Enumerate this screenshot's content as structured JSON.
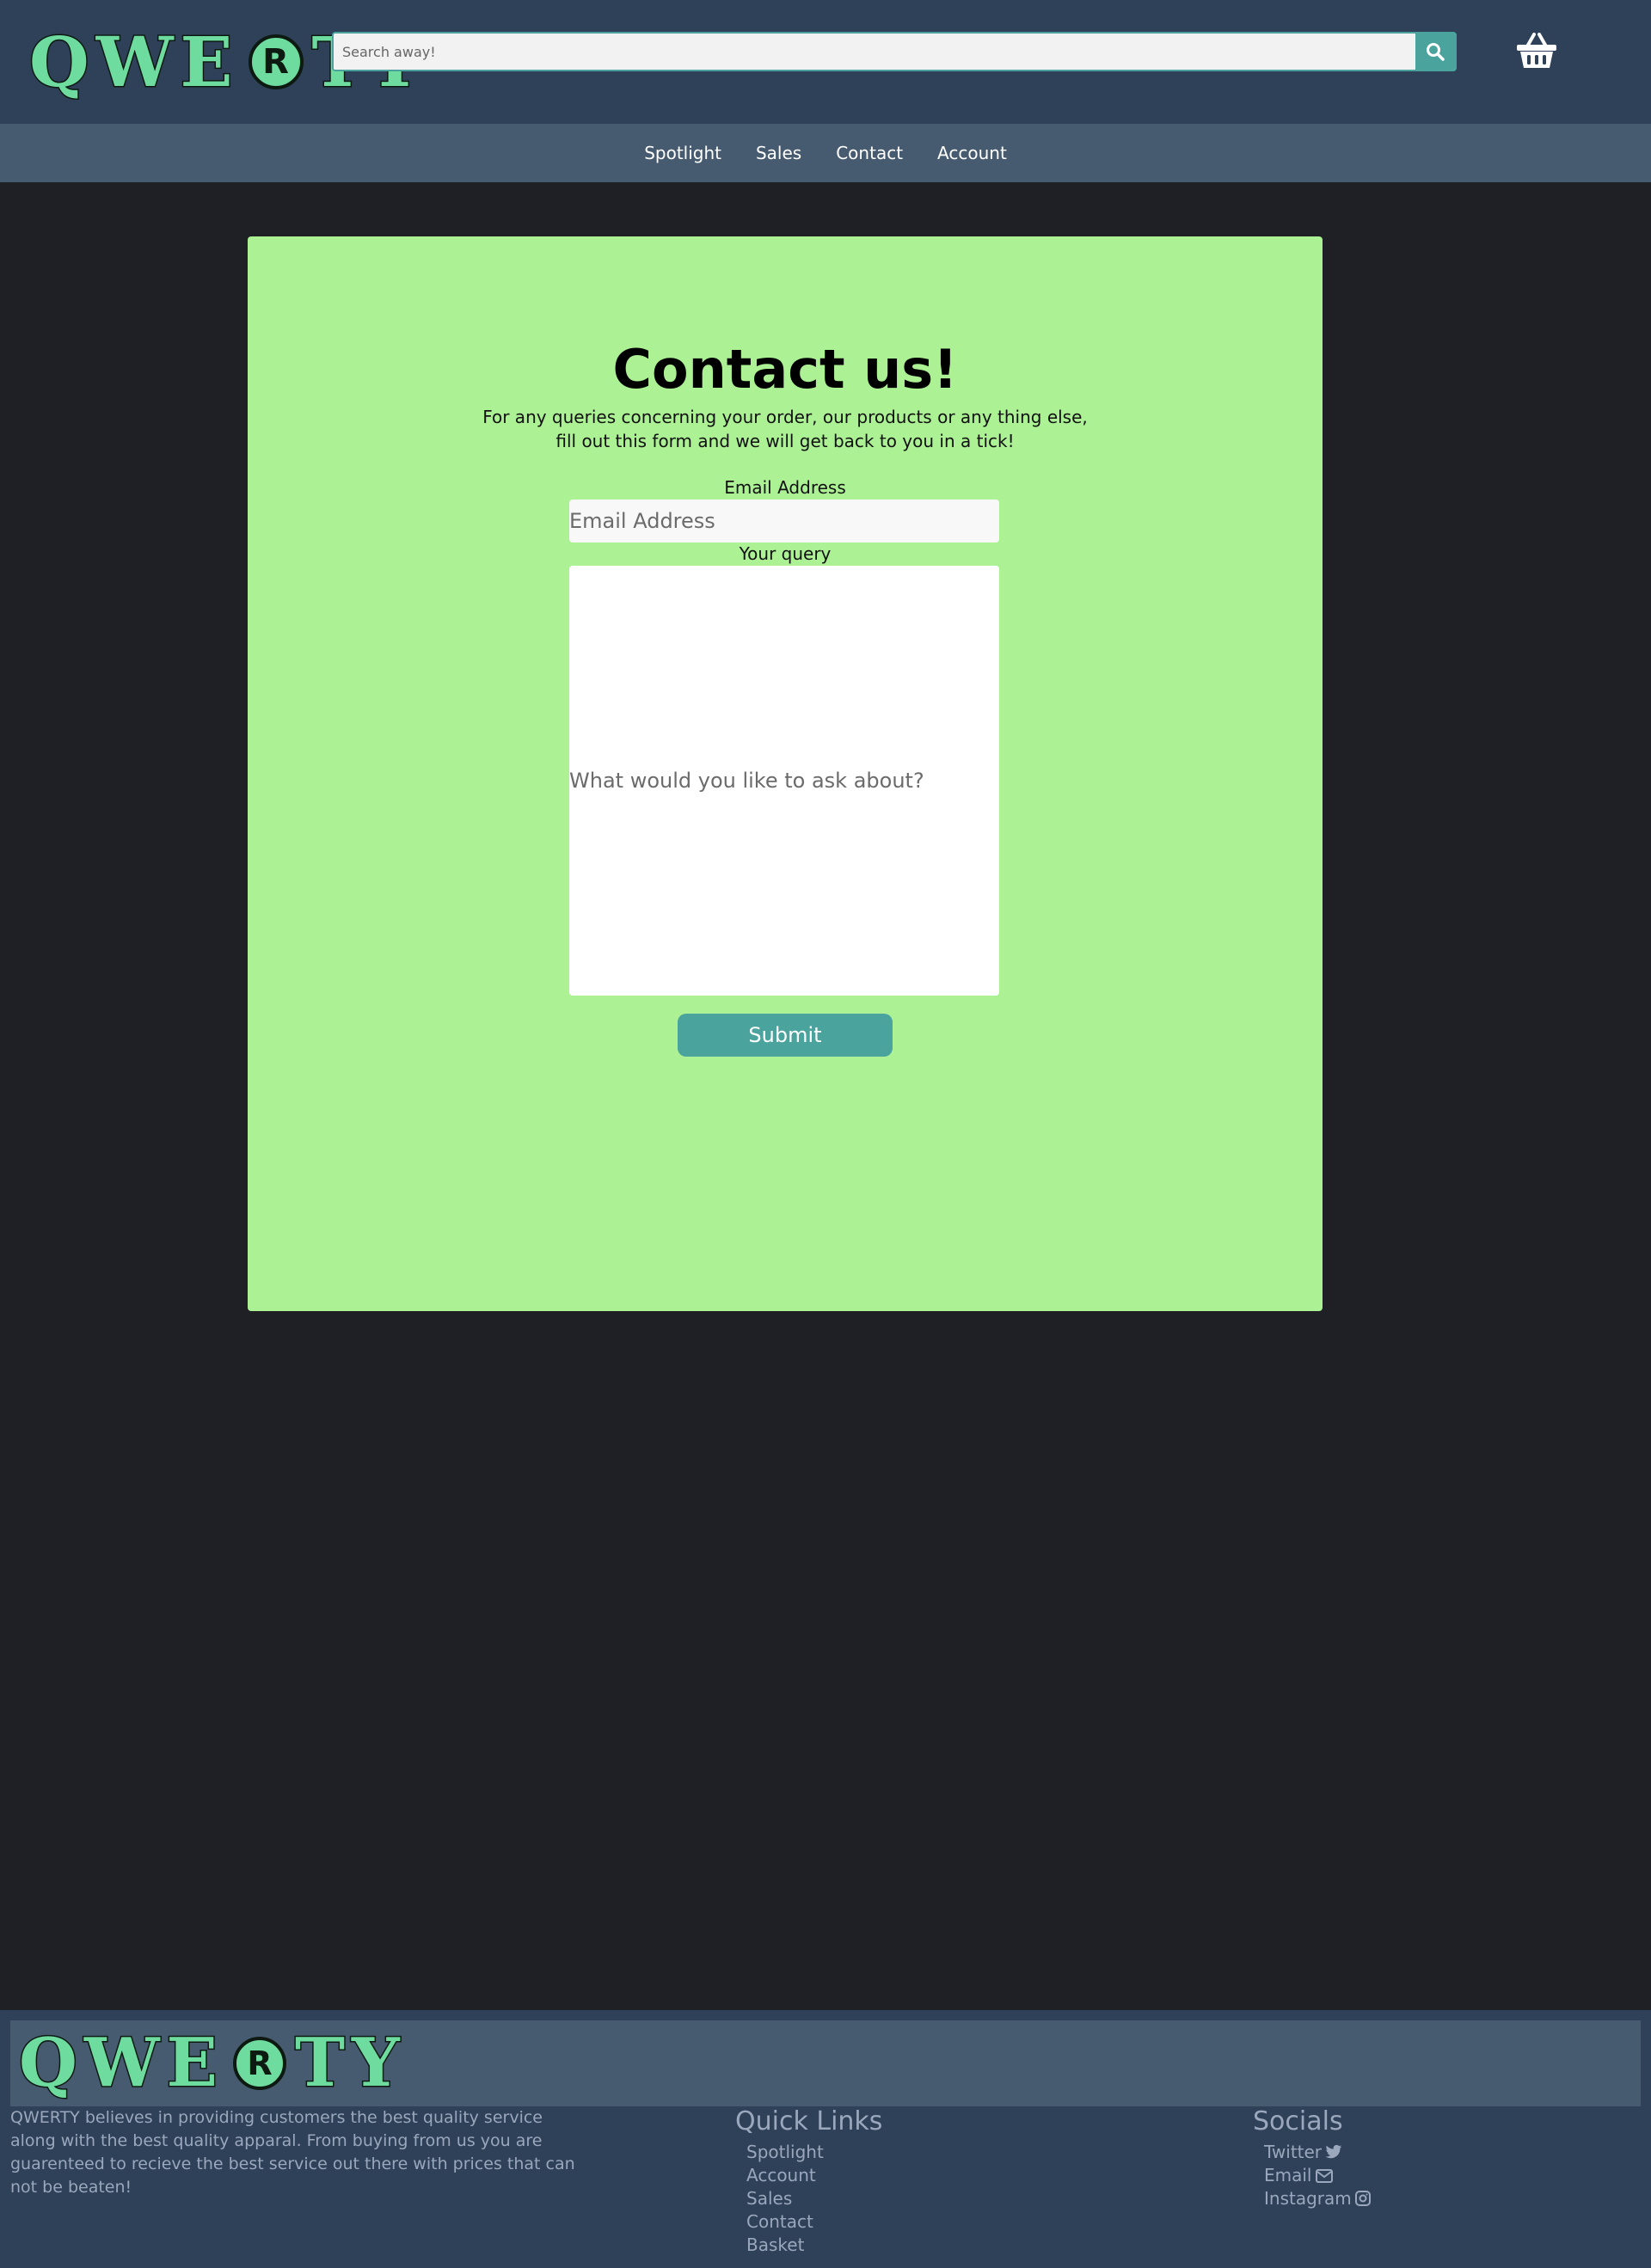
{
  "header": {
    "logo": {
      "letters_left": "QWE",
      "mark": "R",
      "letters_right": "TY"
    },
    "search": {
      "placeholder": "Search away!",
      "button_icon": "search-icon"
    },
    "basket_icon": "basket-icon"
  },
  "nav": {
    "items": [
      {
        "label": "Spotlight"
      },
      {
        "label": "Sales"
      },
      {
        "label": "Contact"
      },
      {
        "label": "Account"
      }
    ]
  },
  "contact": {
    "title": "Contact us!",
    "intro_line1": "For any queries concerning your order, our products or any thing else,",
    "intro_line2": "fill out this form and we will get back to you in a tick!",
    "email_label": "Email Address",
    "email_placeholder": "Email Address",
    "query_label": "Your query",
    "query_placeholder": "What would you like to ask about?",
    "submit_label": "Submit"
  },
  "footer": {
    "logo": {
      "letters_left": "QWE",
      "mark": "R",
      "letters_right": "TY"
    },
    "about": "QWERTY believes in providing customers the best quality service along with the best quality apparal. From buying from us you are guarenteed to recieve the best service out there with prices that can not be beaten!",
    "quick_links": {
      "title": "Quick Links",
      "items": [
        "Spotlight",
        "Account",
        "Sales",
        "Contact",
        "Basket"
      ]
    },
    "socials": {
      "title": "Socials",
      "items": [
        {
          "label": "Twitter",
          "icon": "twitter-icon"
        },
        {
          "label": "Email",
          "icon": "envelope-icon"
        },
        {
          "label": "Instagram",
          "icon": "instagram-icon"
        }
      ]
    }
  },
  "colors": {
    "header_bg": "#2e4159",
    "nav_bg": "#475b70",
    "page_bg": "#1e2025",
    "card_bg": "#adf195",
    "accent": "#4aa39d",
    "logo_green": "#6fdc9f",
    "footer_text": "#9aa7bc"
  }
}
